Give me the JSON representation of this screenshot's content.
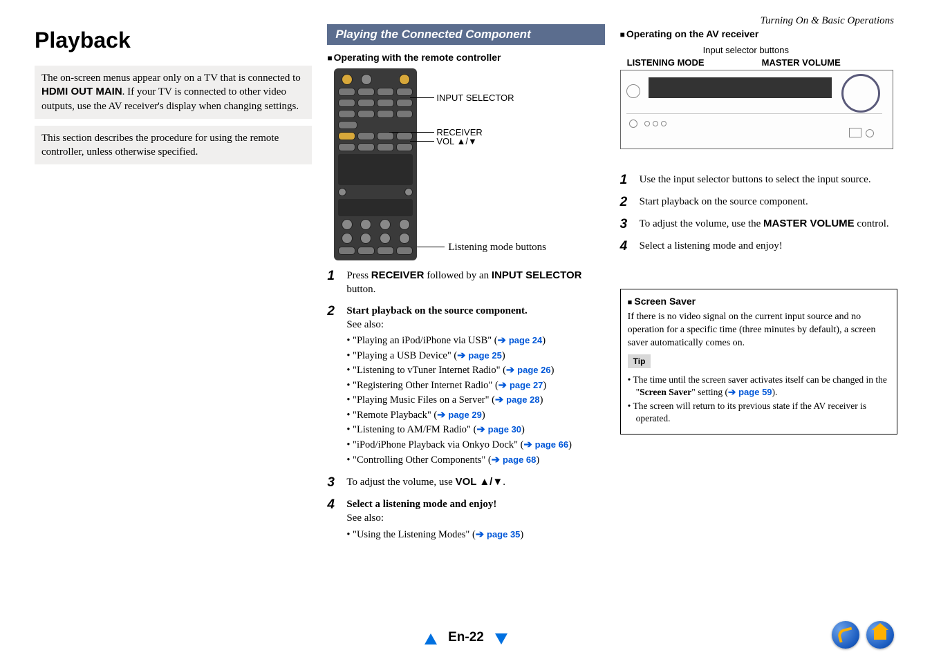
{
  "header_right": "Turning On & Basic Operations",
  "page_title": "Playback",
  "note1_pre": "The on-screen menus appear only on a TV that is connected to ",
  "note1_bold": "HDMI OUT MAIN",
  "note1_post": ". If your TV is connected to other video outputs, use the AV receiver's display when changing settings.",
  "note2": "This section describes the procedure for using the remote controller, unless otherwise specified.",
  "section_bar": "Playing the Connected Component",
  "sub_remote": "Operating with the remote controller",
  "remote_labels": {
    "input": "INPUT SELECTOR",
    "receiver": "RECEIVER",
    "vol": "VOL ▲/▼",
    "listening": "Listening mode buttons"
  },
  "steps_remote": {
    "s1_pre": "Press ",
    "s1_b1": "RECEIVER",
    "s1_mid": " followed by an ",
    "s1_b2": "INPUT SELECTOR",
    "s1_post": " button.",
    "s2": "Start playback on the source component.",
    "s2_see": "See also:",
    "s3_pre": "To adjust the volume, use ",
    "s3_b": "VOL ▲/▼",
    "s3_post": ".",
    "s4": "Select a listening mode and enjoy!",
    "s4_see": "See also:"
  },
  "bullets2": [
    {
      "t": "\"Playing an iPod/iPhone via USB\" (",
      "p": "page 24",
      "e": ")"
    },
    {
      "t": "\"Playing a USB Device\" (",
      "p": "page 25",
      "e": ")"
    },
    {
      "t": "\"Listening to vTuner Internet Radio\" (",
      "p": "page 26",
      "e": ")"
    },
    {
      "t": "\"Registering Other Internet Radio\" (",
      "p": "page 27",
      "e": ")"
    },
    {
      "t": "\"Playing Music Files on a Server\" (",
      "p": "page 28",
      "e": ")"
    },
    {
      "t": "\"Remote Playback\" (",
      "p": "page 29",
      "e": ")"
    },
    {
      "t": "\"Listening to AM/FM Radio\" (",
      "p": "page 30",
      "e": ")"
    },
    {
      "t": "\"iPod/iPhone Playback via Onkyo Dock\" (",
      "p": "page 66",
      "e": ")"
    },
    {
      "t": "\"Controlling Other Components\" (",
      "p": "page 68",
      "e": ")"
    }
  ],
  "bullets4": [
    {
      "t": "\"Using the Listening Modes\" (",
      "p": "page 35",
      "e": ")"
    }
  ],
  "sub_av": "Operating on the AV receiver",
  "device_labels": {
    "top": "Input selector buttons",
    "left": "LISTENING MODE",
    "right": "MASTER VOLUME"
  },
  "steps_av": {
    "s1": "Use the input selector buttons to select the input source.",
    "s2": "Start playback on the source component.",
    "s3_pre": "To adjust the volume, use the ",
    "s3_b": "MASTER VOLUME",
    "s3_post": " control.",
    "s4": "Select a listening mode and enjoy!"
  },
  "ss": {
    "head": "Screen Saver",
    "body": "If there is no video signal on the current input source and no operation for a specific time (three minutes by default), a screen saver automatically comes on.",
    "tip": "Tip",
    "t1_pre": "The time until the screen saver activates itself can be changed in the \"",
    "t1_b": "Screen Saver",
    "t1_mid": "\" setting (",
    "t1_p": "page 59",
    "t1_post": ").",
    "t2": "The screen will return to its previous state if the AV receiver is operated."
  },
  "page_num": "En-22"
}
